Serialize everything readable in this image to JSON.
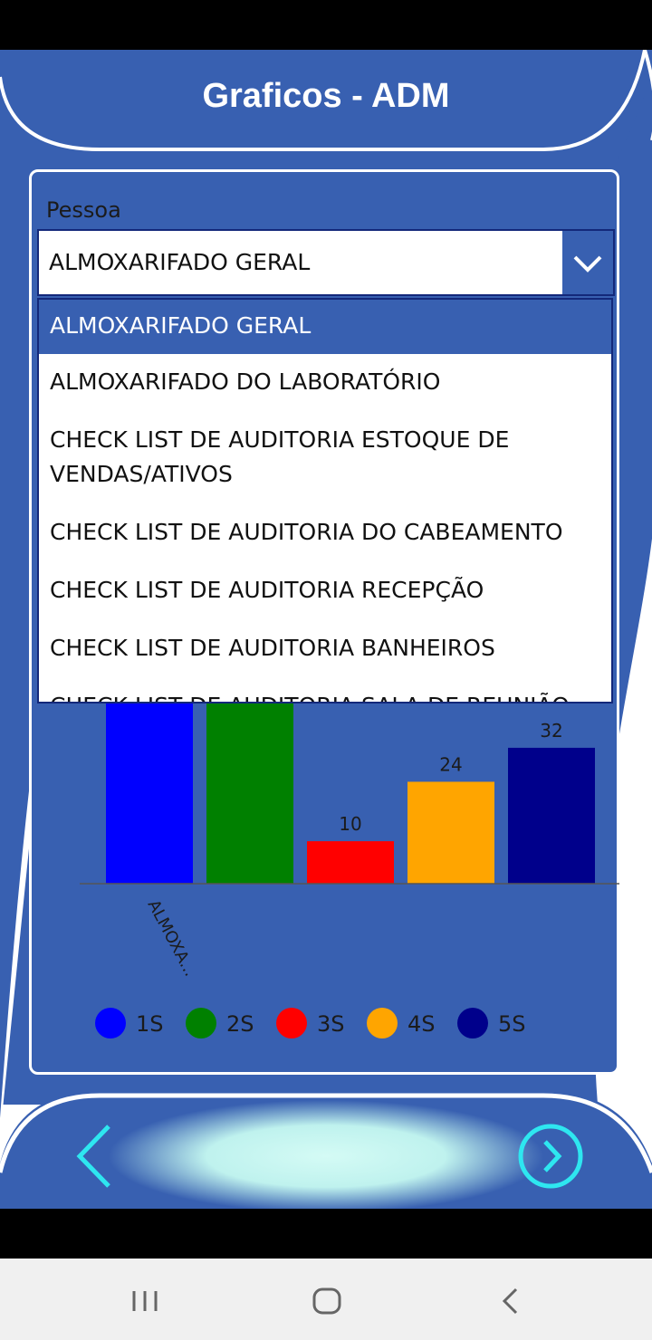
{
  "header": {
    "title": "Graficos - ADM"
  },
  "filter": {
    "label": "Pessoa",
    "selected": "ALMOXARIFADO GERAL",
    "options": [
      "ALMOXARIFADO GERAL",
      "ALMOXARIFADO DO LABORATÓRIO",
      "CHECK LIST DE AUDITORIA ESTOQUE DE VENDAS/ATIVOS",
      "CHECK LIST DE AUDITORIA DO CABEAMENTO",
      "CHECK LIST DE AUDITORIA RECEPÇÃO",
      "CHECK LIST DE AUDITORIA BANHEIROS",
      "CHECK LIST DE AUDITORIA SALA DE REUNIÃO"
    ]
  },
  "chart_data": {
    "type": "bar",
    "categories": [
      "ALMOXA..."
    ],
    "series": [
      {
        "name": "1S",
        "values": [
          null
        ],
        "color": "#0000FF"
      },
      {
        "name": "2S",
        "values": [
          null
        ],
        "color": "#008000"
      },
      {
        "name": "3S",
        "values": [
          10
        ],
        "color": "#FF0000"
      },
      {
        "name": "4S",
        "values": [
          24
        ],
        "color": "#FFA500"
      },
      {
        "name": "5S",
        "values": [
          32
        ],
        "color": "#00008B"
      }
    ],
    "grid": false,
    "legend": "bottom"
  },
  "colors": {
    "primary": "#3860B1",
    "accent": "#2EE6F0"
  },
  "footer": {
    "back_icon": "chevron-left-icon",
    "next_icon": "circle-chevron-right-icon"
  },
  "system_nav": {
    "recents_icon": "recents-icon",
    "home_icon": "home-icon",
    "back_icon": "back-icon"
  }
}
